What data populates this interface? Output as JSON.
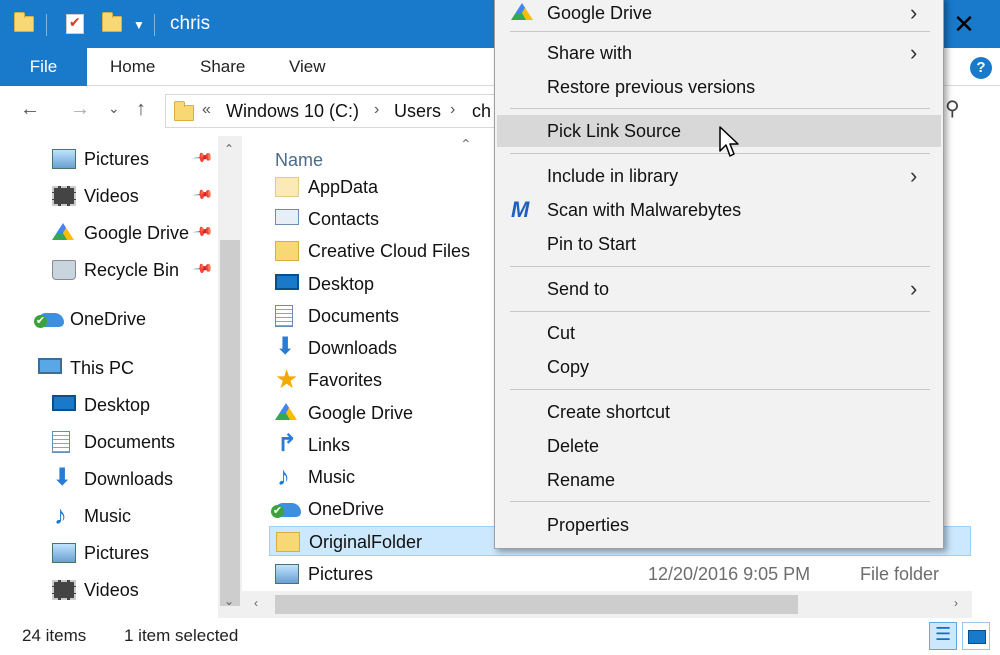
{
  "window": {
    "title": "chris",
    "close_glyph": "✕"
  },
  "ribbon": {
    "tabs": [
      "File",
      "Home",
      "Share",
      "View"
    ],
    "help_glyph": "?"
  },
  "navigation": {
    "back_glyph": "←",
    "forward_glyph": "→",
    "recent_glyph": "⌄",
    "up_glyph": "↑",
    "overflow_glyph": "«",
    "breadcrumbs": [
      "Windows 10 (C:)",
      "Users",
      "chris"
    ],
    "crumb_sep": "›",
    "search_glyph": "⚲"
  },
  "nav_pane": {
    "quick_access": [
      {
        "label": "Pictures",
        "icon": "pictures-icon",
        "pinned": true
      },
      {
        "label": "Videos",
        "icon": "videos-icon",
        "pinned": true
      },
      {
        "label": "Google Drive",
        "icon": "google-drive-icon",
        "pinned": true
      },
      {
        "label": "Recycle Bin",
        "icon": "recycle-bin-icon",
        "pinned": true
      }
    ],
    "onedrive": {
      "label": "OneDrive",
      "icon": "onedrive-icon"
    },
    "this_pc": {
      "label": "This PC",
      "icon": "computer-icon"
    },
    "this_pc_items": [
      {
        "label": "Desktop",
        "icon": "desktop-icon"
      },
      {
        "label": "Documents",
        "icon": "documents-icon"
      },
      {
        "label": "Downloads",
        "icon": "downloads-icon"
      },
      {
        "label": "Music",
        "icon": "music-icon"
      },
      {
        "label": "Pictures",
        "icon": "pictures-icon"
      },
      {
        "label": "Videos",
        "icon": "videos-icon"
      }
    ],
    "pin_glyph": "📌",
    "scroll_up": "⌃",
    "scroll_down": "⌄"
  },
  "file_list": {
    "column_name": "Name",
    "sort_glyph": "⌃",
    "items": [
      {
        "name": "AppData",
        "icon": "appdata-folder-icon"
      },
      {
        "name": "Contacts",
        "icon": "contacts-icon"
      },
      {
        "name": "Creative Cloud Files",
        "icon": "folder-icon"
      },
      {
        "name": "Desktop",
        "icon": "desktop-icon"
      },
      {
        "name": "Documents",
        "icon": "documents-icon"
      },
      {
        "name": "Downloads",
        "icon": "downloads-icon"
      },
      {
        "name": "Favorites",
        "icon": "favorites-icon"
      },
      {
        "name": "Google Drive",
        "icon": "google-drive-icon"
      },
      {
        "name": "Links",
        "icon": "links-icon"
      },
      {
        "name": "Music",
        "icon": "music-icon"
      },
      {
        "name": "OneDrive",
        "icon": "onedrive-icon"
      },
      {
        "name": "OriginalFolder",
        "icon": "folder-icon",
        "selected": true
      },
      {
        "name": "Pictures",
        "icon": "pictures-icon",
        "date": "12/20/2016 9:05 PM",
        "type": "File folder"
      }
    ],
    "hscroll_left": "‹",
    "hscroll_right": "›"
  },
  "status": {
    "item_count": "24 items",
    "selection": "1 item selected"
  },
  "context_menu": {
    "items": [
      {
        "label": "Google Drive",
        "icon": "google-drive-icon",
        "submenu": true
      },
      {
        "label": "Share with",
        "submenu": true
      },
      {
        "label": "Restore previous versions"
      },
      {
        "label": "Pick Link Source",
        "hover": true
      },
      {
        "label": "Include in library",
        "submenu": true
      },
      {
        "label": "Scan with Malwarebytes",
        "icon": "malwarebytes-icon"
      },
      {
        "label": "Pin to Start"
      },
      {
        "label": "Send to",
        "submenu": true
      },
      {
        "label": "Cut"
      },
      {
        "label": "Copy"
      },
      {
        "label": "Create shortcut"
      },
      {
        "label": "Delete"
      },
      {
        "label": "Rename"
      },
      {
        "label": "Properties"
      }
    ],
    "submenu_glyph": "›"
  },
  "colors": {
    "accent": "#1979ca",
    "selection": "#cce8ff",
    "menu_bg": "#f2f2f2",
    "menu_hover": "#d8d8d8"
  }
}
